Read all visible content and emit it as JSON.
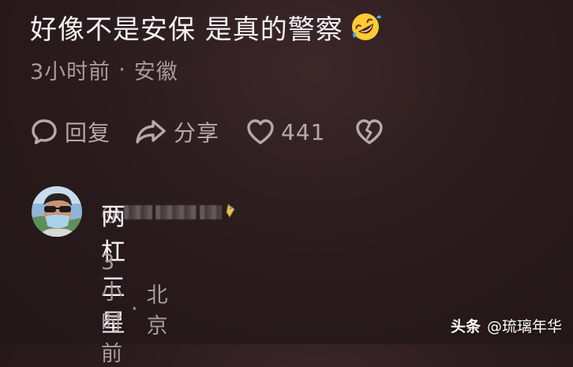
{
  "comment": {
    "text": "好像不是安保 是真的警察",
    "emoji": "rolling-on-floor-laughing",
    "time": "3小时前",
    "separator": "·",
    "location": "安徽"
  },
  "actions": {
    "reply_label": "回复",
    "share_label": "分享",
    "like_count": "441",
    "icons": [
      "speech-bubble-icon",
      "share-arrow-icon",
      "heart-icon",
      "broken-heart-icon"
    ]
  },
  "reply": {
    "user_prefix": "@",
    "text": "两杠三星",
    "time": "3小时前",
    "separator": "·",
    "location": "北京"
  },
  "watermark": {
    "brand": "头条",
    "handle": "@琉璃年华"
  },
  "colors": {
    "background": "#2b1c1d",
    "primary_text": "#f6f2f2",
    "secondary_text": "#a89b9c",
    "action_text": "#b6a9aa"
  }
}
